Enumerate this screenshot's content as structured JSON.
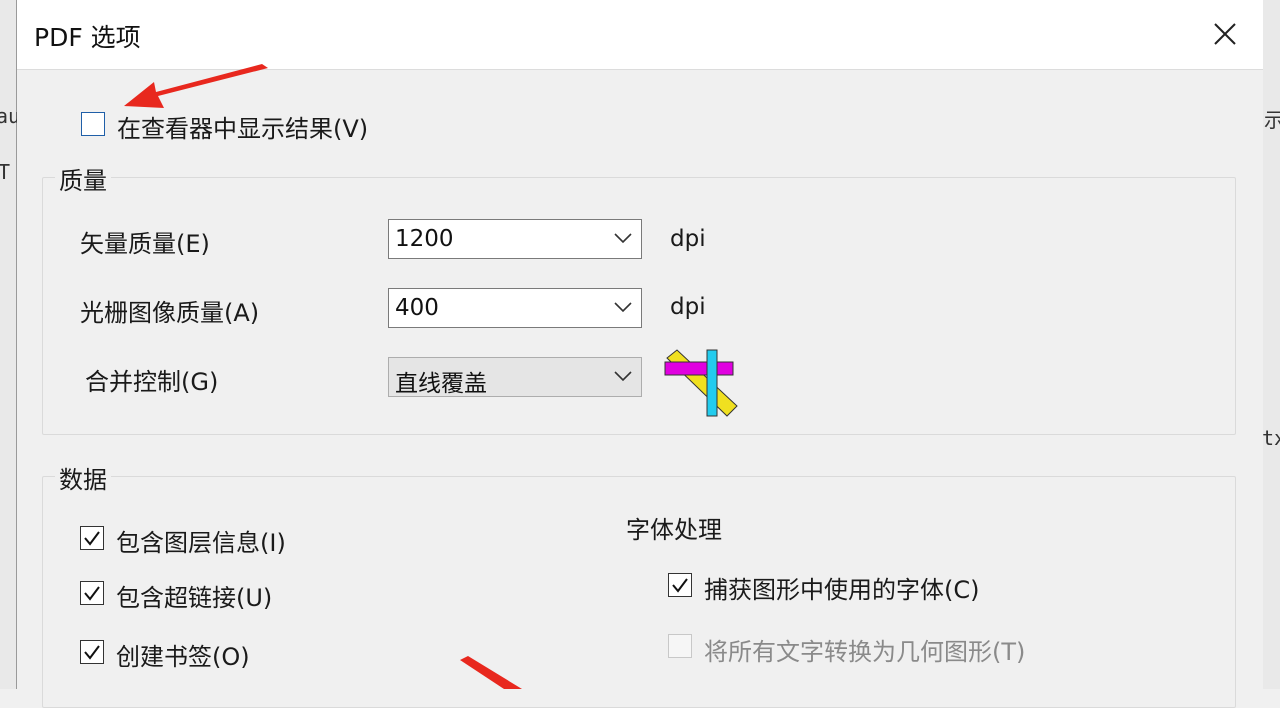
{
  "dialog": {
    "title": "PDF 选项",
    "show_in_viewer": {
      "label": "在查看器中显示结果(V)",
      "checked": false
    }
  },
  "quality": {
    "title": "质量",
    "vector": {
      "label": "矢量质量(E)",
      "value": "1200",
      "unit": "dpi"
    },
    "raster": {
      "label": "光栅图像质量(A)",
      "value": "400",
      "unit": "dpi"
    },
    "merge": {
      "label": "合并控制(G)",
      "value": "直线覆盖"
    }
  },
  "data": {
    "title": "数据",
    "items": [
      {
        "label": "包含图层信息(I)",
        "checked": true
      },
      {
        "label": "包含超链接(U)",
        "checked": true
      },
      {
        "label": "创建书签(O)",
        "checked": true
      }
    ],
    "font_handling": {
      "title": "字体处理",
      "capture_fonts": {
        "label": "捕获图形中使用的字体(C)",
        "checked": true
      },
      "convert_text": {
        "label": "将所有文字转换为几何图形(T)",
        "checked": false,
        "enabled": false
      }
    }
  },
  "background": {
    "left_fragments": [
      "au",
      "T"
    ],
    "right_fragments": [
      "示",
      "tx"
    ]
  },
  "colors": {
    "annotation_arrow": "#e8281e",
    "checkbox_focus": "#1f5fa8",
    "merge_icon_magenta": "#e000e0",
    "merge_icon_cyan": "#22ccee",
    "merge_icon_yellow": "#f0e020"
  }
}
